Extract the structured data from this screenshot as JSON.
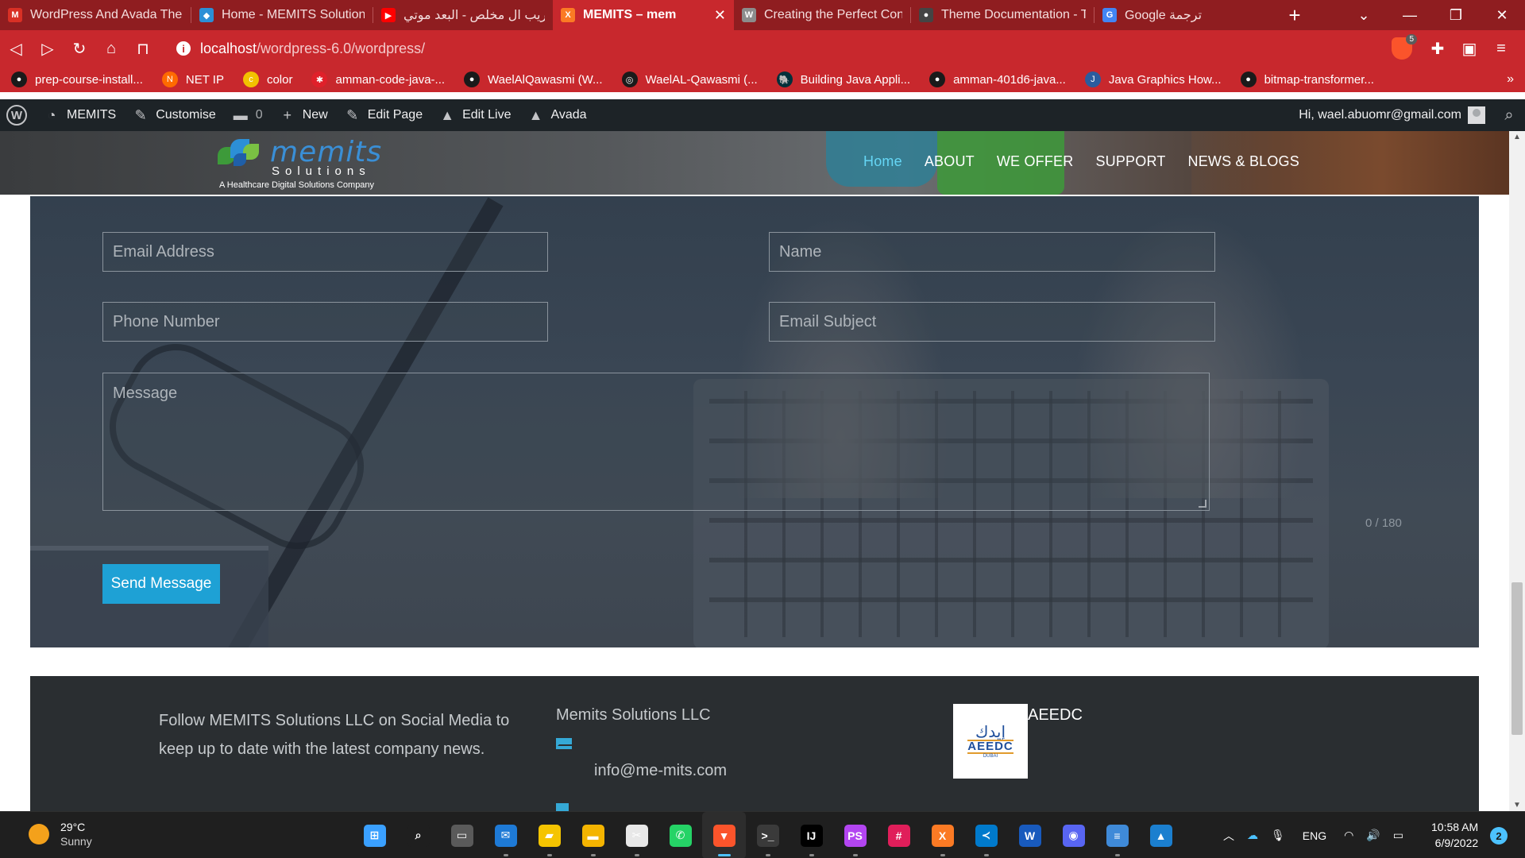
{
  "browser": {
    "tabs": [
      {
        "title": "WordPress And Avada Ther",
        "icon": "gmail-icon",
        "color": "#d93025",
        "glyph": "M"
      },
      {
        "title": "Home - MEMITS Solutions",
        "icon": "memits-favicon-icon",
        "color": "#2c8fd6",
        "glyph": "◆"
      },
      {
        "title": "غريب ال مخلص - البعد موتي",
        "icon": "youtube-icon",
        "color": "#ff0000",
        "glyph": "▶"
      },
      {
        "title": "MEMITS – mem",
        "icon": "xampp-icon",
        "color": "#fb7a24",
        "glyph": "X",
        "active": true
      },
      {
        "title": "Creating the Perfect Contac",
        "icon": "wpforms-icon",
        "color": "#8c8c8c",
        "glyph": "W"
      },
      {
        "title": "Theme Documentation - Th",
        "icon": "theme-doc-icon",
        "color": "#444444",
        "glyph": "●"
      },
      {
        "title": "Google ترجمة",
        "icon": "google-translate-icon",
        "color": "#4285f4",
        "glyph": "G"
      }
    ],
    "url_host": "localhost",
    "url_path": "/wordpress-6.0/wordpress/",
    "shield_count": "5",
    "bookmarks": [
      {
        "label": "prep-course-install...",
        "icon": "github-icon",
        "color": "#1a1a1a",
        "glyph": "●"
      },
      {
        "label": "NET IP",
        "icon": "netip-icon",
        "color": "#ff6a00",
        "glyph": "N"
      },
      {
        "label": "color",
        "icon": "color-icon",
        "color": "#f2c200",
        "glyph": "c"
      },
      {
        "label": "amman-code-java-...",
        "icon": "codefellows-icon",
        "color": "#e0202a",
        "glyph": "✱"
      },
      {
        "label": "WaelAlQawasmi (W...",
        "icon": "github-icon",
        "color": "#1a1a1a",
        "glyph": "●"
      },
      {
        "label": "WaelAL-Qawasmi (...",
        "icon": "leetcode-icon",
        "color": "#1a1a1a",
        "glyph": "◎"
      },
      {
        "label": "Building Java Appli...",
        "icon": "gradle-icon",
        "color": "#02303a",
        "glyph": "🐘"
      },
      {
        "label": "amman-401d6-java...",
        "icon": "github-icon",
        "color": "#1a1a1a",
        "glyph": "●"
      },
      {
        "label": "Java Graphics How...",
        "icon": "java-icon",
        "color": "#2a5c9e",
        "glyph": "J"
      },
      {
        "label": "bitmap-transformer...",
        "icon": "github-icon",
        "color": "#1a1a1a",
        "glyph": "●"
      }
    ]
  },
  "wp_admin_bar": {
    "site_name": "MEMITS",
    "customise": "Customise",
    "comments_count": "0",
    "new": "New",
    "edit_page": "Edit Page",
    "edit_live": "Edit Live",
    "avada": "Avada",
    "greeting": "Hi, wael.abuomr@gmail.com"
  },
  "site": {
    "logo_brand": "memits",
    "logo_sub": "Solutions",
    "logo_tagline": "A Healthcare Digital Solutions Company",
    "nav": [
      "Home",
      "ABOUT",
      "WE OFFER",
      "SUPPORT",
      "NEWS & BLOGS"
    ],
    "accent": "#65d6f5"
  },
  "contact_form": {
    "email_placeholder": "Email Address",
    "name_placeholder": "Name",
    "phone_placeholder": "Phone Number",
    "subject_placeholder": "Email Subject",
    "message_placeholder": "Message",
    "counter": "0 / 180",
    "submit": "Send Message",
    "button_color": "#1ea1d5"
  },
  "footer": {
    "follow_text": "Follow MEMITS Solutions LLC on Social Media to keep up to date with the latest company news.",
    "company": "Memits Solutions LLC",
    "email": "info@me-mits.com",
    "partner_name": "AEEDC",
    "partner_logo_ar": "إيدك",
    "partner_logo_en": "AEEDC",
    "partner_logo_city": "DUBAI"
  },
  "taskbar": {
    "temperature": "29°C",
    "condition": "Sunny",
    "time": "10:58 AM",
    "date": "6/9/2022",
    "language": "ENG",
    "notifications": "2",
    "apps": [
      {
        "name": "start-icon",
        "color": "#3aa0ff",
        "glyph": "⊞"
      },
      {
        "name": "search-icon",
        "color": "#1f1f1f",
        "glyph": "⌕"
      },
      {
        "name": "task-view-icon",
        "color": "#5a5a5a",
        "glyph": "▭"
      },
      {
        "name": "mail-icon",
        "color": "#1e7ad6",
        "glyph": "✉"
      },
      {
        "name": "sticky-notes-icon",
        "color": "#f5c400",
        "glyph": "▰"
      },
      {
        "name": "file-explorer-icon",
        "color": "#f4b400",
        "glyph": "▬"
      },
      {
        "name": "snipping-tool-icon",
        "color": "#e8e8e8",
        "glyph": "✂"
      },
      {
        "name": "whatsapp-icon",
        "color": "#25d366",
        "glyph": "✆"
      },
      {
        "name": "brave-icon",
        "color": "#fb542b",
        "glyph": "▼",
        "active": true
      },
      {
        "name": "terminal-icon",
        "color": "#3a3a3a",
        "glyph": ">_"
      },
      {
        "name": "intellij-icon",
        "color": "#000000",
        "glyph": "IJ"
      },
      {
        "name": "phpstorm-icon",
        "color": "#b345f1",
        "glyph": "PS"
      },
      {
        "name": "slack-icon",
        "color": "#e01e5a",
        "glyph": "#"
      },
      {
        "name": "xampp-icon",
        "color": "#fb7a24",
        "glyph": "X"
      },
      {
        "name": "vscode-icon",
        "color": "#007acc",
        "glyph": "≺"
      },
      {
        "name": "word-icon",
        "color": "#185abd",
        "glyph": "W"
      },
      {
        "name": "discord-icon",
        "color": "#5865f2",
        "glyph": "◉"
      },
      {
        "name": "notepad-icon",
        "color": "#3f8ad8",
        "glyph": "≡"
      },
      {
        "name": "photos-icon",
        "color": "#1b7fcf",
        "glyph": "▲"
      }
    ]
  }
}
